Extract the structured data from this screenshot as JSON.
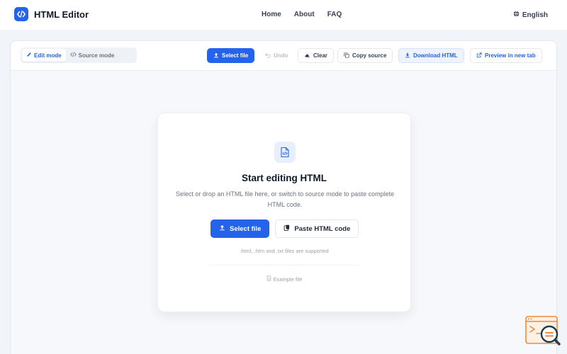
{
  "header": {
    "brand_title": "HTML Editor",
    "nav": [
      "Home",
      "About",
      "FAQ"
    ],
    "language": "English"
  },
  "toolbar": {
    "edit_mode": "Edit mode",
    "source_mode": "Source mode",
    "select_file": "Select file",
    "undo": "Undo",
    "clear": "Clear",
    "copy_source": "Copy source",
    "download_html": "Download HTML",
    "preview": "Preview in new tab"
  },
  "card": {
    "title": "Start editing HTML",
    "description": "Select or drop an HTML file here, or switch to source mode to paste complete HTML code.",
    "select_file": "Select file",
    "paste_code": "Paste HTML code",
    "supported": ".html, .htm and .txt files are supported",
    "example": "Example file"
  },
  "colors": {
    "accent": "#2563eb",
    "background": "#f1f4f8",
    "widget": "#ef8a3c"
  },
  "icons": [
    "code-icon",
    "globe-icon",
    "pencil-icon",
    "source-code-icon",
    "upload-icon",
    "undo-icon",
    "eraser-icon",
    "copy-icon",
    "download-icon",
    "external-link-icon",
    "file-code-icon",
    "clipboard-icon",
    "file-icon",
    "search-widget-icon"
  ]
}
